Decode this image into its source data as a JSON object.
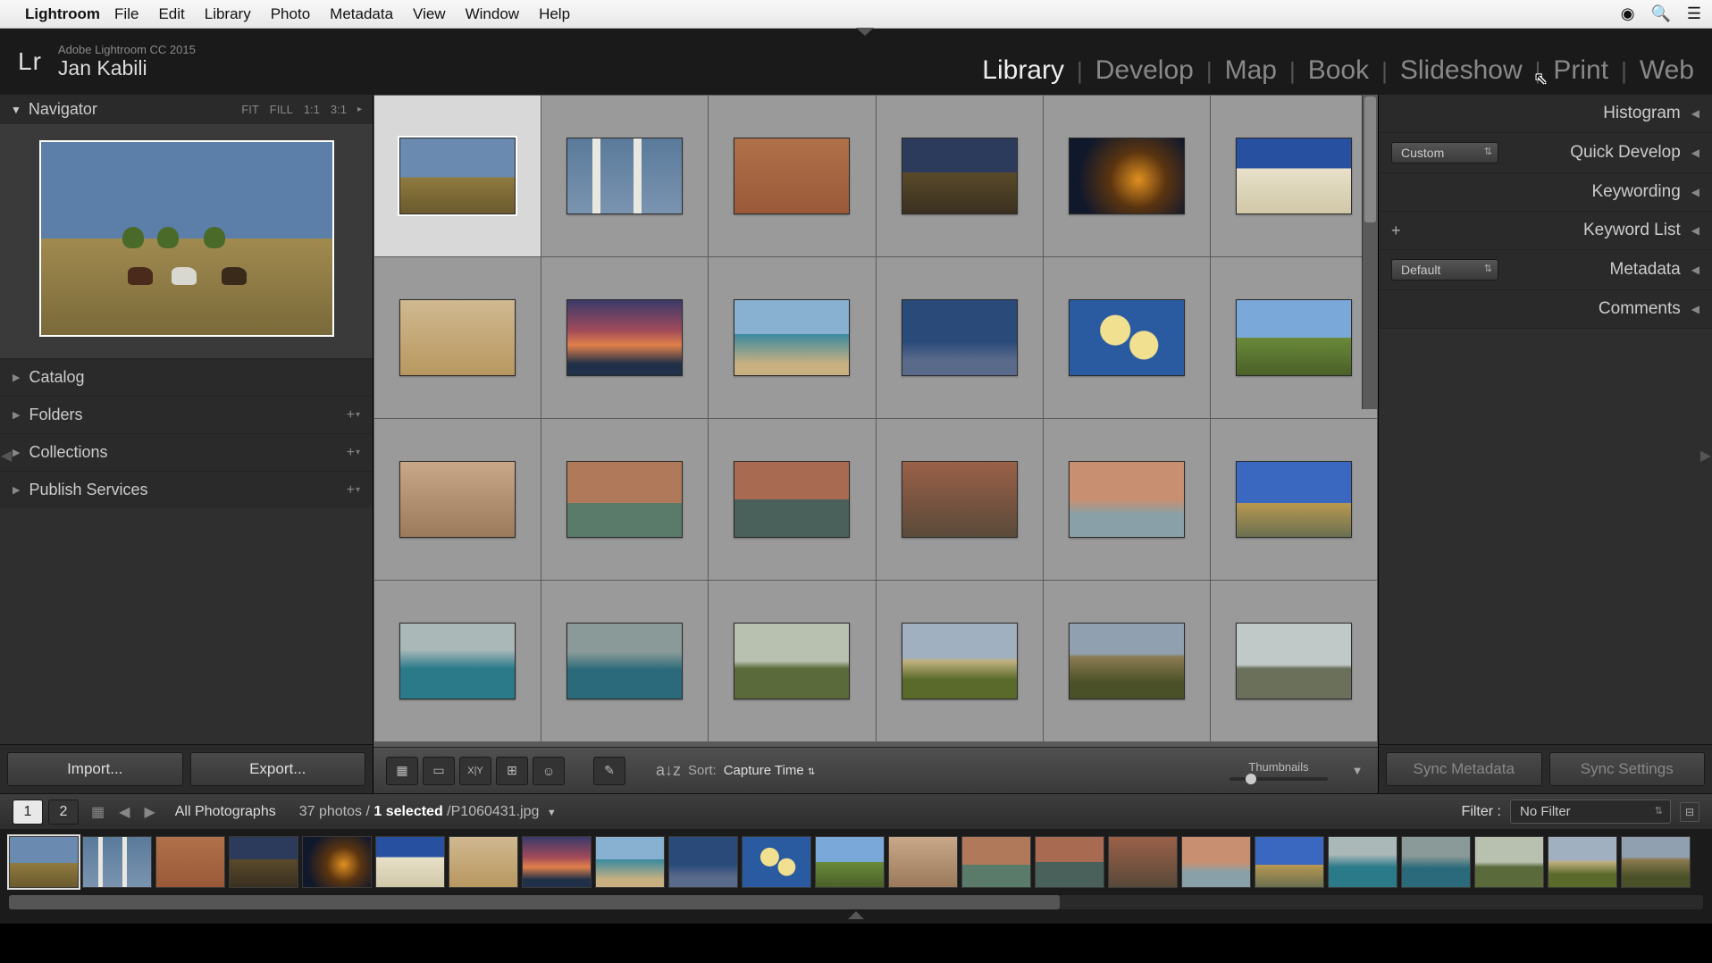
{
  "mac_menu": {
    "app": "Lightroom",
    "items": [
      "File",
      "Edit",
      "Library",
      "Photo",
      "Metadata",
      "View",
      "Window",
      "Help"
    ]
  },
  "header": {
    "version": "Adobe Lightroom CC 2015",
    "user": "Jan Kabili",
    "modules": [
      "Library",
      "Develop",
      "Map",
      "Book",
      "Slideshow",
      "Print",
      "Web"
    ],
    "active_module": "Library"
  },
  "left": {
    "navigator": "Navigator",
    "zoom": [
      "FIT",
      "FILL",
      "1:1",
      "3:1"
    ],
    "sections": {
      "catalog": "Catalog",
      "folders": "Folders",
      "collections": "Collections",
      "publish": "Publish Services"
    },
    "buttons": {
      "import": "Import...",
      "export": "Export..."
    }
  },
  "grid": {
    "thumbs": [
      "th-horses",
      "th-birch",
      "th-adobe",
      "th-fence",
      "th-night",
      "th-ir",
      "th-medwall",
      "th-sunset",
      "th-beach",
      "th-pier",
      "th-roses",
      "th-hill",
      "th-steps",
      "th-canal1",
      "th-canal2",
      "th-canal3",
      "th-bridge",
      "th-road",
      "th-gorge",
      "th-gorge2",
      "th-blossom",
      "th-church",
      "th-castle",
      "th-valley"
    ],
    "toolbar": {
      "sort_label": "Sort:",
      "sort_value": "Capture Time",
      "thumbs_label": "Thumbnails"
    }
  },
  "right": {
    "histogram": "Histogram",
    "quick_develop": "Quick Develop",
    "quick_dd": "Custom",
    "keywording": "Keywording",
    "keyword_list": "Keyword List",
    "metadata": "Metadata",
    "metadata_dd": "Default",
    "comments": "Comments",
    "buttons": {
      "sync_meta": "Sync Metadata",
      "sync_settings": "Sync Settings"
    }
  },
  "info_bar": {
    "pages": [
      "1",
      "2"
    ],
    "source": "All Photographs",
    "count_prefix": "37 photos / ",
    "selected": "1 selected",
    "filename": " /P1060431.jpg",
    "filter_label": "Filter :",
    "filter_value": "No Filter"
  },
  "filmstrip": {
    "thumbs": [
      "th-horses",
      "th-birch",
      "th-adobe",
      "th-fence",
      "th-night",
      "th-ir",
      "th-medwall",
      "th-sunset",
      "th-beach",
      "th-pier",
      "th-roses",
      "th-hill",
      "th-steps",
      "th-canal1",
      "th-canal2",
      "th-canal3",
      "th-bridge",
      "th-road",
      "th-gorge",
      "th-gorge2",
      "th-blossom",
      "th-church",
      "th-castle"
    ]
  }
}
